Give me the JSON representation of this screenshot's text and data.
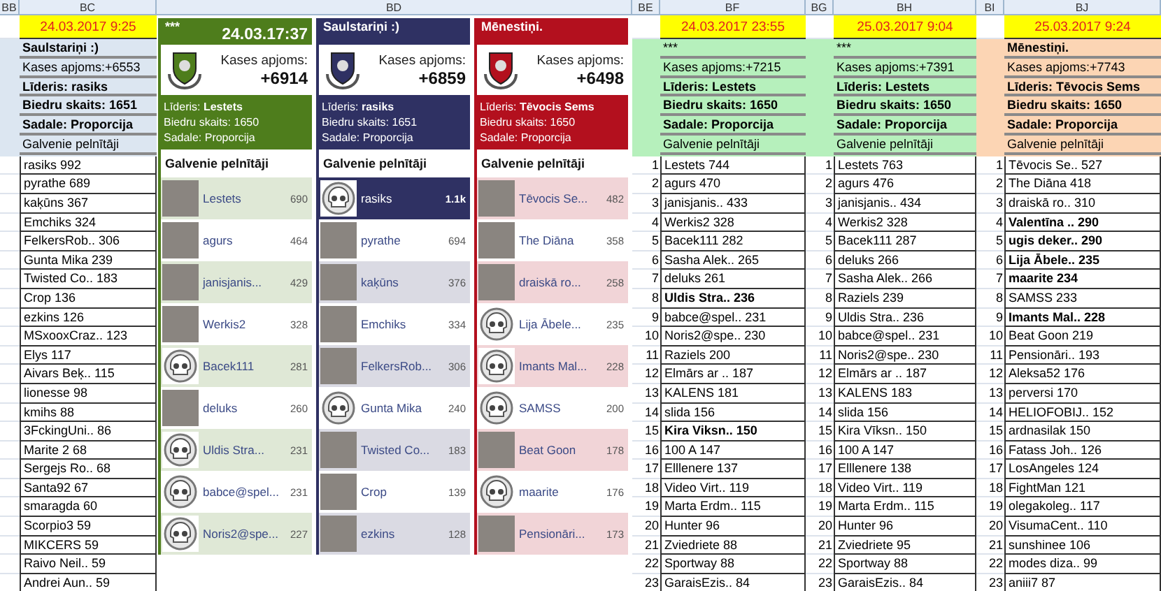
{
  "column_headers": [
    "BB",
    "BC",
    "BD",
    "BE",
    "BF",
    "BG",
    "BH",
    "BI",
    "BJ"
  ],
  "snapshot_before_cards": {
    "date": "24.03.2017 9:25",
    "color": "#dce6f1",
    "info": [
      {
        "text": "Saulstariņi :)",
        "bold": true
      },
      {
        "text": "Kases apjoms:+6553",
        "bold": false
      },
      {
        "text": "Līderis: rasiks",
        "bold": true
      },
      {
        "text": "Biedru skaits: 1651",
        "bold": true
      },
      {
        "text": "Sadale: Proporcija",
        "bold": true
      },
      {
        "text": "Galvenie pelnītāji",
        "bold": false
      }
    ],
    "entries": [
      {
        "text": "rasiks 992",
        "bold": false
      },
      {
        "text": "pyrathe 689",
        "bold": false
      },
      {
        "text": "kaķūns 367",
        "bold": false
      },
      {
        "text": "Emchiks 324",
        "bold": false
      },
      {
        "text": "FelkersRob.. 306",
        "bold": false
      },
      {
        "text": "Gunta Mika 239",
        "bold": false
      },
      {
        "text": "Twisted Co.. 183",
        "bold": false
      },
      {
        "text": "Crop 136",
        "bold": false
      },
      {
        "text": "ezkins 126",
        "bold": false
      },
      {
        "text": "MSxooxCraz.. 123",
        "bold": false
      },
      {
        "text": "Elys 117",
        "bold": false
      },
      {
        "text": "Aivars Beķ.. 115",
        "bold": false
      },
      {
        "text": "lionesse 98",
        "bold": false
      },
      {
        "text": "kmihs 88",
        "bold": false
      },
      {
        "text": "3FckingUni.. 86",
        "bold": false
      },
      {
        "text": "Marite 2 68",
        "bold": false
      },
      {
        "text": "Sergejs Ro.. 68",
        "bold": false
      },
      {
        "text": "Santa92 67",
        "bold": false
      },
      {
        "text": "smaragda 60",
        "bold": false
      },
      {
        "text": "Scorpio3 59",
        "bold": false
      },
      {
        "text": "MIKCERS 59",
        "bold": false
      },
      {
        "text": "Raivo Neil.. 59",
        "bold": false
      },
      {
        "text": "Andrei Aun.. 59",
        "bold": false
      }
    ]
  },
  "clan_cards": [
    {
      "color": "#4e7d1c",
      "title": "***",
      "date": "24.03.17:37",
      "treasury_label": "Kases apjoms:",
      "treasury": "+6914",
      "leader": "Līderis: **Lestets**",
      "members": "Biedru skaits: 1650",
      "split": "Sadale: Proporcija",
      "heading": "Galvenie pelnītāji",
      "earners": [
        {
          "name": "Lestets",
          "score": "690",
          "kind": "photo",
          "highlighted": false
        },
        {
          "name": "agurs",
          "score": "464",
          "kind": "photo",
          "highlighted": false
        },
        {
          "name": "janisjanis...",
          "score": "429",
          "kind": "photo",
          "highlighted": false
        },
        {
          "name": "Werkis2",
          "score": "328",
          "kind": "photo",
          "highlighted": false
        },
        {
          "name": "Bacek111",
          "score": "281",
          "kind": "skull",
          "highlighted": false
        },
        {
          "name": "deluks",
          "score": "260",
          "kind": "photo",
          "highlighted": false
        },
        {
          "name": "Uldis Stra...",
          "score": "231",
          "kind": "skull",
          "highlighted": false
        },
        {
          "name": "babce@spel...",
          "score": "231",
          "kind": "skull",
          "highlighted": false
        },
        {
          "name": "Noris2@spe...",
          "score": "227",
          "kind": "skull",
          "highlighted": false
        }
      ]
    },
    {
      "color": "#2f3163",
      "title": "Saulstariņi :)",
      "treasury_label": "Kases apjoms:",
      "treasury": "+6859",
      "leader": "Līderis: **rasiks**",
      "members": "Biedru skaits: 1651",
      "split": "Sadale: Proporcija",
      "heading": "Galvenie pelnītāji",
      "earners": [
        {
          "name": "rasiks",
          "score": "1.1k",
          "kind": "skull",
          "highlighted": true
        },
        {
          "name": "pyrathe",
          "score": "694",
          "kind": "photo",
          "highlighted": false
        },
        {
          "name": "kaķūns",
          "score": "376",
          "kind": "photo",
          "highlighted": false
        },
        {
          "name": "Emchiks",
          "score": "334",
          "kind": "photo",
          "highlighted": false
        },
        {
          "name": "FelkersRob...",
          "score": "306",
          "kind": "photo",
          "highlighted": false
        },
        {
          "name": "Gunta Mika",
          "score": "240",
          "kind": "skull",
          "highlighted": false
        },
        {
          "name": "Twisted Co...",
          "score": "183",
          "kind": "photo",
          "highlighted": false
        },
        {
          "name": "Crop",
          "score": "139",
          "kind": "photo",
          "highlighted": false
        },
        {
          "name": "ezkins",
          "score": "128",
          "kind": "photo",
          "highlighted": false
        }
      ]
    },
    {
      "color": "#b3101e",
      "title": "Mēnestiņi.",
      "treasury_label": "Kases apjoms:",
      "treasury": "+6498",
      "leader": "Līderis: **Tēvocis Sems**",
      "members": "Biedru skaits: 1650",
      "split": "Sadale: Proporcija",
      "heading": "Galvenie pelnītāji",
      "earners": [
        {
          "name": "Tēvocis Se...",
          "score": "482",
          "kind": "photo",
          "highlighted": false
        },
        {
          "name": "The Diāna",
          "score": "358",
          "kind": "photo",
          "highlighted": false
        },
        {
          "name": "draiskā ro...",
          "score": "258",
          "kind": "photo",
          "highlighted": false
        },
        {
          "name": "Lija Ābele...",
          "score": "235",
          "kind": "skull",
          "highlighted": false
        },
        {
          "name": "Imants Mal...",
          "score": "228",
          "kind": "skull",
          "highlighted": false
        },
        {
          "name": "SAMSS",
          "score": "200",
          "kind": "skull",
          "highlighted": false
        },
        {
          "name": "Beat Goon",
          "score": "178",
          "kind": "photo",
          "highlighted": false
        },
        {
          "name": "maarite",
          "score": "176",
          "kind": "skull",
          "highlighted": false
        },
        {
          "name": "Pensionāri...",
          "score": "173",
          "kind": "photo",
          "highlighted": false
        }
      ]
    }
  ],
  "snapshots_after_cards": [
    {
      "date": "24.03.2017 23:55",
      "color": "#b6f0bc",
      "info": [
        {
          "text": "***",
          "bold": false
        },
        {
          "text": "Kases apjoms:+7215",
          "bold": false
        },
        {
          "text": "Līderis: Lestets",
          "bold": true
        },
        {
          "text": "Biedru skaits: 1650",
          "bold": true
        },
        {
          "text": "Sadale: Proporcija",
          "bold": true
        },
        {
          "text": "Galvenie pelnītāji",
          "bold": false
        }
      ],
      "entries": [
        {
          "rank": "1",
          "text": "Lestets 744",
          "bold": false
        },
        {
          "rank": "2",
          "text": "agurs 470",
          "bold": false
        },
        {
          "rank": "3",
          "text": "janisjanis.. 433",
          "bold": false
        },
        {
          "rank": "4",
          "text": "Werkis2 328",
          "bold": false
        },
        {
          "rank": "5",
          "text": "Bacek111 282",
          "bold": false
        },
        {
          "rank": "6",
          "text": "Sasha Alek.. 265",
          "bold": false
        },
        {
          "rank": "7",
          "text": "deluks 261",
          "bold": false
        },
        {
          "rank": "8",
          "text": "Uldis Stra.. 236",
          "bold": true
        },
        {
          "rank": "9",
          "text": "babce@spel.. 231",
          "bold": false
        },
        {
          "rank": "10",
          "text": "Noris2@spe.. 230",
          "bold": false
        },
        {
          "rank": "11",
          "text": "Raziels 200",
          "bold": false
        },
        {
          "rank": "12",
          "text": "Elmārs ar .. 187",
          "bold": false
        },
        {
          "rank": "13",
          "text": "KALENS 181",
          "bold": false
        },
        {
          "rank": "14",
          "text": "slida 156",
          "bold": false
        },
        {
          "rank": "15",
          "text": "Kira Viksn.. 150",
          "bold": true
        },
        {
          "rank": "16",
          "text": "100 A 147",
          "bold": false
        },
        {
          "rank": "17",
          "text": "Elllenere 137",
          "bold": false
        },
        {
          "rank": "18",
          "text": "Video Virt.. 119",
          "bold": false
        },
        {
          "rank": "19",
          "text": "Marta Erdm.. 115",
          "bold": false
        },
        {
          "rank": "20",
          "text": "Hunter 96",
          "bold": false
        },
        {
          "rank": "21",
          "text": "Zviedriete 88",
          "bold": false
        },
        {
          "rank": "22",
          "text": "Sportway 88",
          "bold": false
        },
        {
          "rank": "23",
          "text": "GaraisEzis.. 84",
          "bold": false
        }
      ]
    },
    {
      "date": "25.03.2017 9:04",
      "color": "#b6f0bc",
      "info": [
        {
          "text": "***",
          "bold": false
        },
        {
          "text": "Kases apjoms:+7391",
          "bold": false
        },
        {
          "text": "Līderis: Lestets",
          "bold": true
        },
        {
          "text": "Biedru skaits: 1650",
          "bold": true
        },
        {
          "text": "Sadale: Proporcija",
          "bold": true
        },
        {
          "text": "Galvenie pelnītāji",
          "bold": false
        }
      ],
      "entries": [
        {
          "rank": "1",
          "text": "Lestets 763",
          "bold": false
        },
        {
          "rank": "2",
          "text": "agurs 476",
          "bold": false
        },
        {
          "rank": "3",
          "text": "janisjanis.. 434",
          "bold": false
        },
        {
          "rank": "4",
          "text": "Werkis2 328",
          "bold": false
        },
        {
          "rank": "5",
          "text": "Bacek111 287",
          "bold": false
        },
        {
          "rank": "6",
          "text": "deluks 266",
          "bold": false
        },
        {
          "rank": "7",
          "text": "Sasha Alek.. 266",
          "bold": false
        },
        {
          "rank": "8",
          "text": "Raziels 239",
          "bold": false
        },
        {
          "rank": "9",
          "text": "Uldis Stra.. 236",
          "bold": false
        },
        {
          "rank": "10",
          "text": "babce@spel.. 231",
          "bold": false
        },
        {
          "rank": "11",
          "text": "Noris2@spe.. 230",
          "bold": false
        },
        {
          "rank": "12",
          "text": "Elmārs ar .. 187",
          "bold": false
        },
        {
          "rank": "13",
          "text": "KALENS 183",
          "bold": false
        },
        {
          "rank": "14",
          "text": "slida 156",
          "bold": false
        },
        {
          "rank": "15",
          "text": "Kira Vīksn.. 150",
          "bold": false
        },
        {
          "rank": "16",
          "text": "100 A 147",
          "bold": false
        },
        {
          "rank": "17",
          "text": "Elllenere 138",
          "bold": false
        },
        {
          "rank": "18",
          "text": "Video Virt.. 119",
          "bold": false
        },
        {
          "rank": "19",
          "text": "Marta Erdm.. 115",
          "bold": false
        },
        {
          "rank": "20",
          "text": "Hunter 96",
          "bold": false
        },
        {
          "rank": "21",
          "text": "Zviedriete 95",
          "bold": false
        },
        {
          "rank": "22",
          "text": "Sportway 88",
          "bold": false
        },
        {
          "rank": "23",
          "text": "GaraisEzis.. 84",
          "bold": false
        }
      ]
    },
    {
      "date": "25.03.2017 9:24",
      "color": "#fcd5b4",
      "info": [
        {
          "text": "Mēnestiņi.",
          "bold": true
        },
        {
          "text": "Kases apjoms:+7743",
          "bold": false
        },
        {
          "text": "Līderis: Tēvocis Sems",
          "bold": true
        },
        {
          "text": "Biedru skaits: 1650",
          "bold": true
        },
        {
          "text": "Sadale: Proporcija",
          "bold": true
        },
        {
          "text": "Galvenie pelnītāji",
          "bold": false
        }
      ],
      "entries": [
        {
          "rank": "1",
          "text": "Tēvocis Se.. 527",
          "bold": false
        },
        {
          "rank": "2",
          "text": "The Diāna 418",
          "bold": false
        },
        {
          "rank": "3",
          "text": "draiskā ro.. 310",
          "bold": false
        },
        {
          "rank": "4",
          "text": "Valentīna .. 290",
          "bold": true
        },
        {
          "rank": "5",
          "text": "ugis deker.. 290",
          "bold": true
        },
        {
          "rank": "6",
          "text": "Lija Ābele.. 235",
          "bold": true
        },
        {
          "rank": "7",
          "text": "maarite 234",
          "bold": true
        },
        {
          "rank": "8",
          "text": "SAMSS 233",
          "bold": false
        },
        {
          "rank": "9",
          "text": "Imants Mal.. 228",
          "bold": true
        },
        {
          "rank": "10",
          "text": "Beat Goon 219",
          "bold": false
        },
        {
          "rank": "11",
          "text": "Pensionāri.. 193",
          "bold": false
        },
        {
          "rank": "12",
          "text": "Aleksa52 176",
          "bold": false
        },
        {
          "rank": "13",
          "text": "perversi 170",
          "bold": false
        },
        {
          "rank": "14",
          "text": "HELIOFOBIJ.. 152",
          "bold": false
        },
        {
          "rank": "15",
          "text": "ardnasilak 150",
          "bold": false
        },
        {
          "rank": "16",
          "text": "Fatass Joh.. 126",
          "bold": false
        },
        {
          "rank": "17",
          "text": "LosAngeles 124",
          "bold": false
        },
        {
          "rank": "18",
          "text": "FightMan 121",
          "bold": false
        },
        {
          "rank": "19",
          "text": "olegakoleg.. 117",
          "bold": false
        },
        {
          "rank": "20",
          "text": "VisumaCent.. 110",
          "bold": false
        },
        {
          "rank": "21",
          "text": "sunshinee 106",
          "bold": false
        },
        {
          "rank": "22",
          "text": "modes diza.. 99",
          "bold": false
        },
        {
          "rank": "23",
          "text": "aniii7 87",
          "bold": false
        }
      ]
    }
  ]
}
